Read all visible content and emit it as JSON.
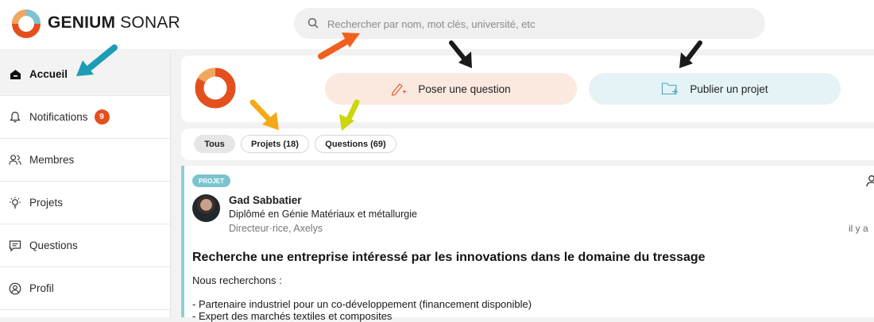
{
  "header": {
    "brand_bold": "GENIUM",
    "brand_light": " SONAR",
    "search": {
      "placeholder": "Rechercher par nom, mot clés, université, etc"
    }
  },
  "sidebar": {
    "items": [
      {
        "label": "Accueil",
        "icon": "home-icon",
        "active": true
      },
      {
        "label": "Notifications",
        "icon": "bell-icon",
        "badge": "9"
      },
      {
        "label": "Membres",
        "icon": "members-icon"
      },
      {
        "label": "Projets",
        "icon": "lightbulb-icon"
      },
      {
        "label": "Questions",
        "icon": "chat-icon"
      },
      {
        "label": "Profil",
        "icon": "profile-icon"
      }
    ]
  },
  "composer": {
    "ask_label": "Poser une question",
    "publish_label": "Publier un projet"
  },
  "filters": {
    "all": "Tous",
    "projects": "Projets (18)",
    "questions": "Questions (69)"
  },
  "post": {
    "tag": "PROJET",
    "author": "Gad Sabbatier",
    "degree": "Diplômé en Génie Matériaux et métallurgie",
    "role": "Directeur·rice, Axelys",
    "time": "il y a",
    "title": "Recherche une entreprise intéressé par les innovations dans le domaine du tressage",
    "body_intro": "Nous recherchons :",
    "body_items": [
      "- Partenaire industriel pour un co-développement (financement disponible)",
      "- Expert des marchés textiles et composites"
    ]
  },
  "colors": {
    "accent_orange": "#e3501e",
    "accent_teal": "#7bc4cf",
    "question_bg": "#fbe9e0",
    "project_bg": "#e5f3f6",
    "arrow_teal": "#1c9db5",
    "arrow_orange": "#f2601d",
    "arrow_yellow": "#f5a819",
    "arrow_lime": "#cdd50c",
    "arrow_black": "#1a1a1a"
  }
}
